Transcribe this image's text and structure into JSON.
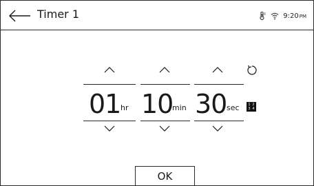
{
  "header": {
    "title": "Timer 1",
    "status": {
      "thermo_icon": "thermometer-icon",
      "wifi_icon": "wifi-icon",
      "time": "9:20",
      "ampm": "PM"
    }
  },
  "timer": {
    "hours": {
      "value": "01",
      "unit": "hr"
    },
    "minutes": {
      "value": "10",
      "unit": "min"
    },
    "seconds": {
      "value": "30",
      "unit": "sec"
    }
  },
  "side": {
    "reset_icon": "reset-icon",
    "keypad_icon": "keypad-icon",
    "keypad_digits": [
      "1",
      "2",
      "3",
      "4"
    ]
  },
  "footer": {
    "ok_label": "OK"
  }
}
